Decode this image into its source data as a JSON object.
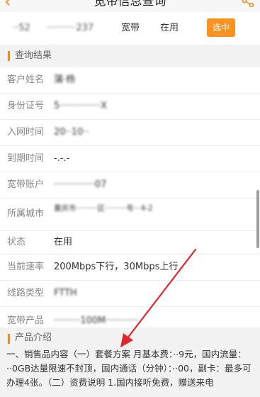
{
  "header": {
    "title": "宽带信息查询",
    "back_icon": "chevron-left-icon",
    "share_icon": "share-icon"
  },
  "account_bar": {
    "account_short": "··52",
    "account_number": "··········237",
    "type": "宽带",
    "status": "在用",
    "select_label": "选中"
  },
  "result_section": {
    "title": "查询结果"
  },
  "fields": [
    {
      "key": "客户姓名",
      "value": "蒲·杨"
    },
    {
      "key": "身份证号",
      "value": "5··············X"
    },
    {
      "key": "入网时间",
      "value": "20··10··"
    },
    {
      "key": "到期时间",
      "value": "-.-.-"
    },
    {
      "key": "宽带账户",
      "value": "··············07"
    },
    {
      "key": "所属城市",
      "value": "重庆市·········区·········号···4-2"
    },
    {
      "key": "状态",
      "value": "在用"
    },
    {
      "key": "当前速率",
      "value": "200Mbps下行，30Mbps上行"
    },
    {
      "key": "线路类型",
      "value": "FTTH"
    },
    {
      "key": "宽带产品",
      "value": "·········100M···········"
    }
  ],
  "product_section": {
    "title": "产品介绍"
  },
  "product_text": "一、销售品内容（一）套餐方案 月基本费：··9元，国内流量：··0GB达量限速不封顶，国内通话（分钟）：··00，副卡：最多可办理4张。（二）资费说明 1.国内接听免费，赠送来电",
  "colors": {
    "accent": "#f7931e",
    "section_bar": "#f08c1a",
    "annotation_arrow": "#e0262c",
    "background": "#f2f2f2"
  }
}
